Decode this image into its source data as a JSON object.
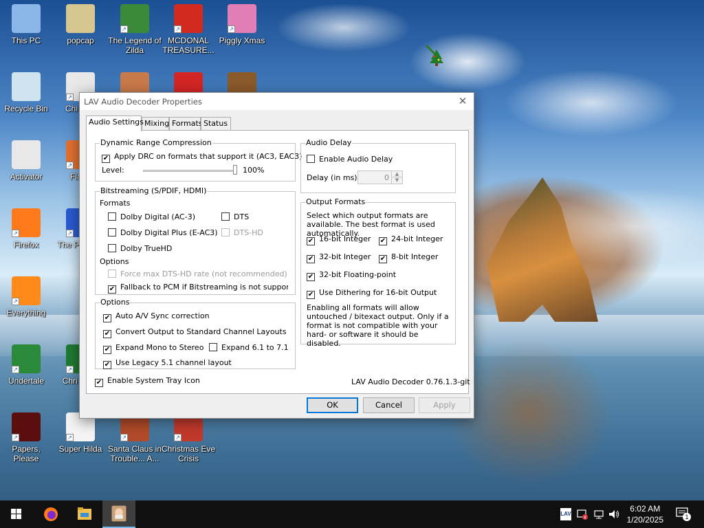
{
  "desktop": {
    "icons": [
      {
        "label": "This PC",
        "color": "#8ab6e8"
      },
      {
        "label": "popcap",
        "color": "#d7c690"
      },
      {
        "label": "The Legend of Zilda",
        "color": "#3a8a3a"
      },
      {
        "label": "MCDONAL TREASURE...",
        "color": "#d22a1e"
      },
      {
        "label": "Piggly Xmas",
        "color": "#e37fb6"
      },
      {
        "label": "Recycle Bin",
        "color": "#d0e4f0"
      },
      {
        "label": "Chi Inva",
        "color": "#e8e8e8"
      },
      {
        "label": "",
        "color": "#c97a4a"
      },
      {
        "label": "",
        "color": "#d42525"
      },
      {
        "label": "",
        "color": "#8a5a2a"
      },
      {
        "label": "Activator",
        "color": "#e8e8e8"
      },
      {
        "label": "Flapp",
        "color": "#e07030"
      },
      {
        "label": "Firefox",
        "color": "#ff7a1a"
      },
      {
        "label": "The P Machi",
        "color": "#2a5ad0"
      },
      {
        "label": "Everything",
        "color": "#ff8a1a"
      },
      {
        "label": "Undertale",
        "color": "#2b8a3a"
      },
      {
        "label": "Chri Brow",
        "color": "#1e7a30"
      },
      {
        "label": "Papers, Please",
        "color": "#5a0e0e"
      },
      {
        "label": "Super Hilda",
        "color": "#f4f4f4"
      },
      {
        "label": "Santa Claus in Trouble... A...",
        "color": "#b04a2a"
      },
      {
        "label": "Christmas Eve Crisis",
        "color": "#c0392b"
      }
    ]
  },
  "dialog": {
    "title": "LAV Audio Decoder Properties",
    "close_glyph": "✕",
    "tabs": [
      "Audio Settings",
      "Mixing",
      "Formats",
      "Status"
    ],
    "active_tab": "Audio Settings",
    "drc": {
      "group_title": "Dynamic Range Compression",
      "apply_label": "Apply DRC on formats that support it (AC3, EAC3)",
      "apply_checked": true,
      "level_label": "Level:",
      "level_value": "100%",
      "level_fraction": 1.0
    },
    "bitstreaming": {
      "group_title": "Bitstreaming (S/PDIF, HDMI)",
      "formats_label": "Formats",
      "dolby_digital": "Dolby Digital (AC-3)",
      "dolby_digital_plus": "Dolby Digital Plus (E-AC3)",
      "dolby_truehd": "Dolby TrueHD",
      "dts": "DTS",
      "dts_hd": "DTS-HD",
      "options_label": "Options",
      "force_dtshd": "Force max DTS-HD rate (not recommended)",
      "fallback_pcm": "Fallback to PCM if Bitstreaming is not supported",
      "fallback_checked": true
    },
    "options": {
      "group_title": "Options",
      "auto_sync": "Auto A/V Sync correction",
      "convert_output": "Convert Output to Standard Channel Layouts",
      "expand_mono": "Expand Mono to Stereo",
      "expand_61": "Expand 6.1 to 7.1",
      "legacy_51": "Use Legacy 5.1 channel layout"
    },
    "tray_icon_label": "Enable System Tray Icon",
    "version": "LAV Audio Decoder 0.76.1.3-git",
    "audio_delay": {
      "group_title": "Audio Delay",
      "enable_label": "Enable Audio Delay",
      "delay_label": "Delay (in ms):",
      "delay_value": "0"
    },
    "output_formats": {
      "group_title": "Output Formats",
      "description": "Select which output formats are available. The best format is used automatically.",
      "int16": "16-bit Integer",
      "int24": "24-bit Integer",
      "int32": "32-bit Integer",
      "int8": "8-bit Integer",
      "float32": "32-bit Floating-point",
      "dithering": "Use Dithering for 16-bit Output",
      "note": "Enabling all formats will allow untouched / bitexact output. Only if a format is not compatible with your hard- or software it should be disabled."
    },
    "buttons": {
      "ok": "OK",
      "cancel": "Cancel",
      "apply": "Apply"
    }
  },
  "taskbar": {
    "time": "6:02 AM",
    "date": "1/20/2025",
    "lav_tray_label": "LAV",
    "notification_count": "1"
  }
}
